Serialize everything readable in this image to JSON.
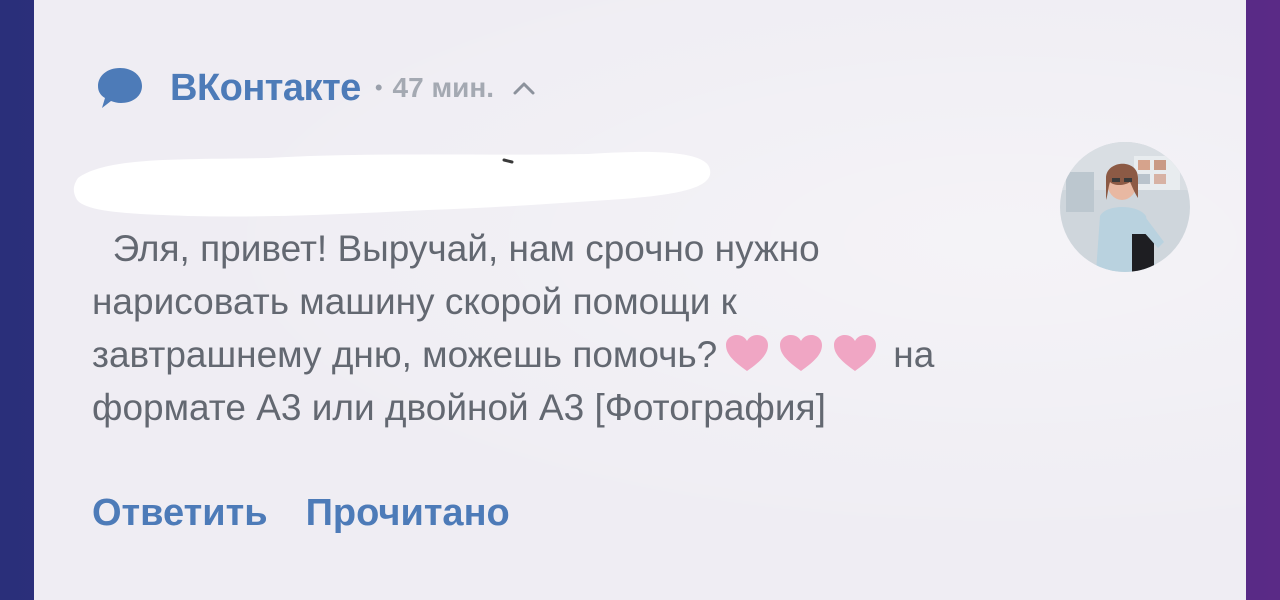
{
  "notification": {
    "app_name": "ВКонтакте",
    "separator": "•",
    "time": "47 мин.",
    "message_line1": "  Эля, привет! Выручай, нам срочно нужно",
    "message_line2": "нарисовать машину скорой помощи к",
    "message_line3a": "завтрашнему дню, можешь помочь?",
    "message_line3b": "на",
    "message_line4": "формате А3 или двойной А3 [Фотография]",
    "hearts_count": 3,
    "icons": {
      "app": "chat-bubble-icon",
      "expand": "chevron-up-icon",
      "heart": "heart-icon"
    }
  },
  "actions": {
    "reply": "Ответить",
    "mark_read": "Прочитано"
  },
  "colors": {
    "accent": "#4d7bb8",
    "text": "#636871",
    "heart": "#f0a6c4",
    "card": "#efedf3"
  }
}
